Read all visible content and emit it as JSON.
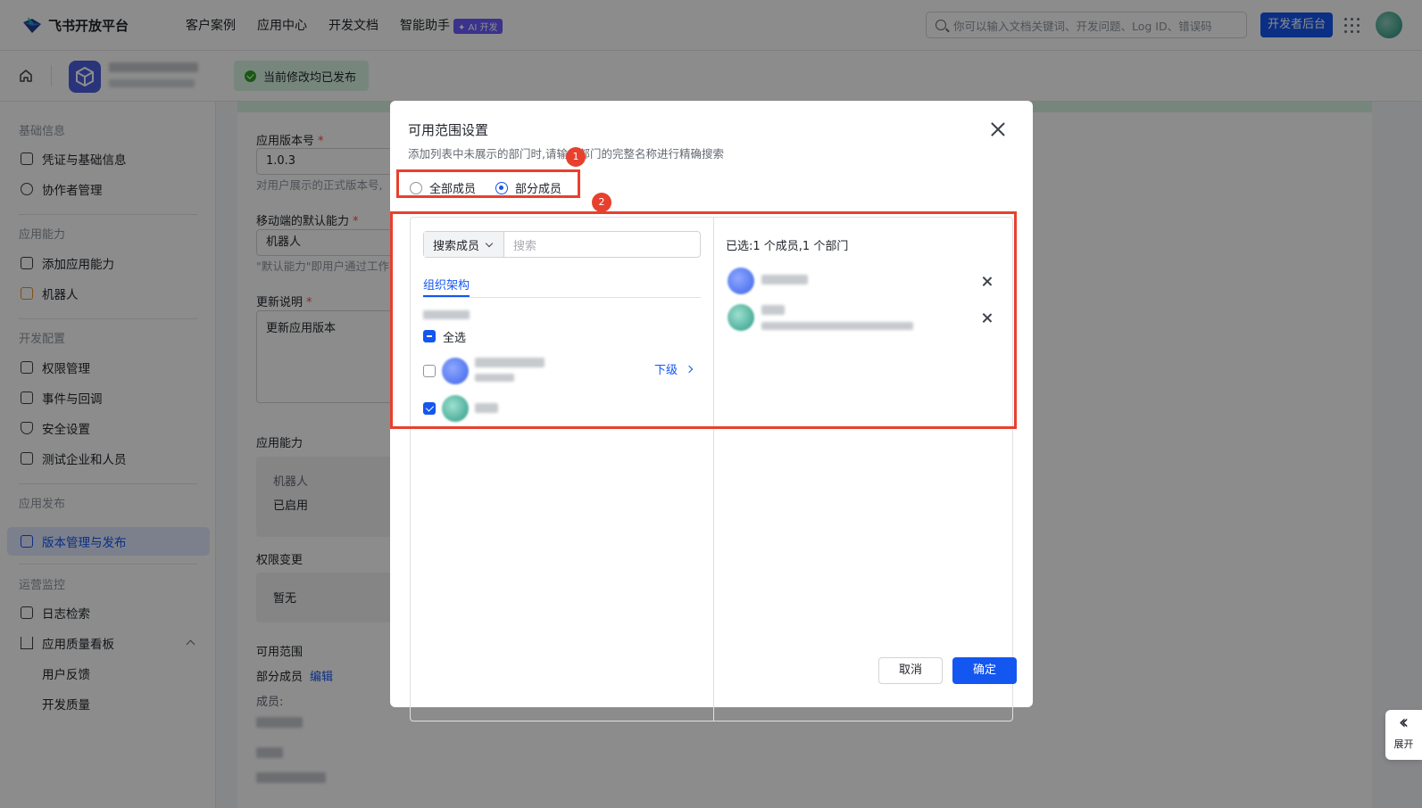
{
  "topnav": {
    "brand": "飞书开放平台",
    "items": [
      "客户案例",
      "应用中心",
      "开发文档",
      "智能助手"
    ],
    "ai_badge": "✦ AI 开发",
    "search_placeholder": "你可以输入文档关键词、开发问题、Log ID、错误码",
    "dev_console": "开发者后台"
  },
  "subheader": {
    "status": "当前修改均已发布"
  },
  "sidebar": {
    "groups": [
      "基础信息",
      "应用能力",
      "开发配置",
      "应用发布",
      "运营监控"
    ],
    "items": [
      {
        "label": "凭证与基础信息"
      },
      {
        "label": "协作者管理"
      },
      {
        "label": "添加应用能力"
      },
      {
        "label": "机器人"
      },
      {
        "label": "权限管理"
      },
      {
        "label": "事件与回调"
      },
      {
        "label": "安全设置"
      },
      {
        "label": "测试企业和人员"
      },
      {
        "label": "版本管理与发布"
      },
      {
        "label": "日志检索"
      },
      {
        "label": "应用质量看板"
      },
      {
        "label": "用户反馈"
      },
      {
        "label": "开发质量"
      }
    ]
  },
  "form": {
    "version_label": "应用版本号",
    "version_value": "1.0.3",
    "version_hint": "对用户展示的正式版本号,",
    "mobile_label": "移动端的默认能力",
    "mobile_value": "机器人",
    "mobile_hint": "\"默认能力\"即用户通过工作",
    "notes_label": "更新说明",
    "notes_value": "更新应用版本",
    "capability_label": "应用能力",
    "capability_name": "机器人",
    "capability_status": "已启用",
    "perm_label": "权限变更",
    "perm_value": "暂无",
    "scope_label": "可用范围",
    "scope_value": "部分成员",
    "scope_edit": "编辑",
    "members_label": "成员:"
  },
  "modal": {
    "title": "可用范围设置",
    "subtitle": "添加列表中未展示的部门时,请输入部门的完整名称进行精确搜索",
    "radio_all": "全部成员",
    "radio_partial": "部分成员",
    "search_type": "搜索成员",
    "search_placeholder": "搜索",
    "tab_org": "组织架构",
    "select_all": "全选",
    "sub_level": "下级",
    "selected_summary": "已选:1 个成员,1 个部门",
    "cancel": "取消",
    "confirm": "确定",
    "badges": [
      "1",
      "2"
    ]
  },
  "expand": "展开"
}
